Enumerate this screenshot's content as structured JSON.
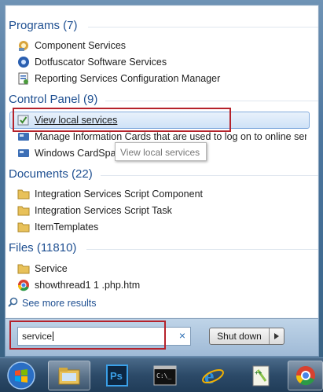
{
  "sections": {
    "programs": {
      "header": "Programs (7)",
      "items": [
        {
          "label": "Component Services",
          "icon": "component-services-icon"
        },
        {
          "label": "Dotfuscator Software Services",
          "icon": "dotfuscator-icon"
        },
        {
          "label": "Reporting Services Configuration Manager",
          "icon": "reporting-services-icon"
        }
      ]
    },
    "control_panel": {
      "header": "Control Panel (9)",
      "items": [
        {
          "label": "View local services",
          "icon": "services-icon"
        },
        {
          "label": "Manage Information Cards that are used to log on to online ser...",
          "icon": "cardspace-icon"
        },
        {
          "label": "Windows CardSpace",
          "icon": "cardspace-icon"
        }
      ]
    },
    "documents": {
      "header": "Documents (22)",
      "items": [
        {
          "label": "Integration Services Script Component",
          "icon": "folder-icon"
        },
        {
          "label": "Integration Services Script Task",
          "icon": "folder-icon"
        },
        {
          "label": "ItemTemplates",
          "icon": "folder-icon"
        }
      ]
    },
    "files": {
      "header": "Files (11810)",
      "items": [
        {
          "label": "Service",
          "icon": "folder-icon"
        },
        {
          "label": "showthread1 1 .php.htm",
          "icon": "chrome-icon"
        }
      ]
    }
  },
  "tooltip": "View local services",
  "see_more": "See more results",
  "search": {
    "value": "service",
    "clear": "×"
  },
  "shutdown": {
    "label": "Shut down",
    "arrow": "▶"
  },
  "taskbar": [
    "start-orb",
    "windows-explorer",
    "photoshop",
    "command-prompt",
    "internet-explorer",
    "notepad-plus-plus",
    "chrome"
  ],
  "colors": {
    "accent": "#1e4f91",
    "highlight_border": "#b5222b"
  }
}
